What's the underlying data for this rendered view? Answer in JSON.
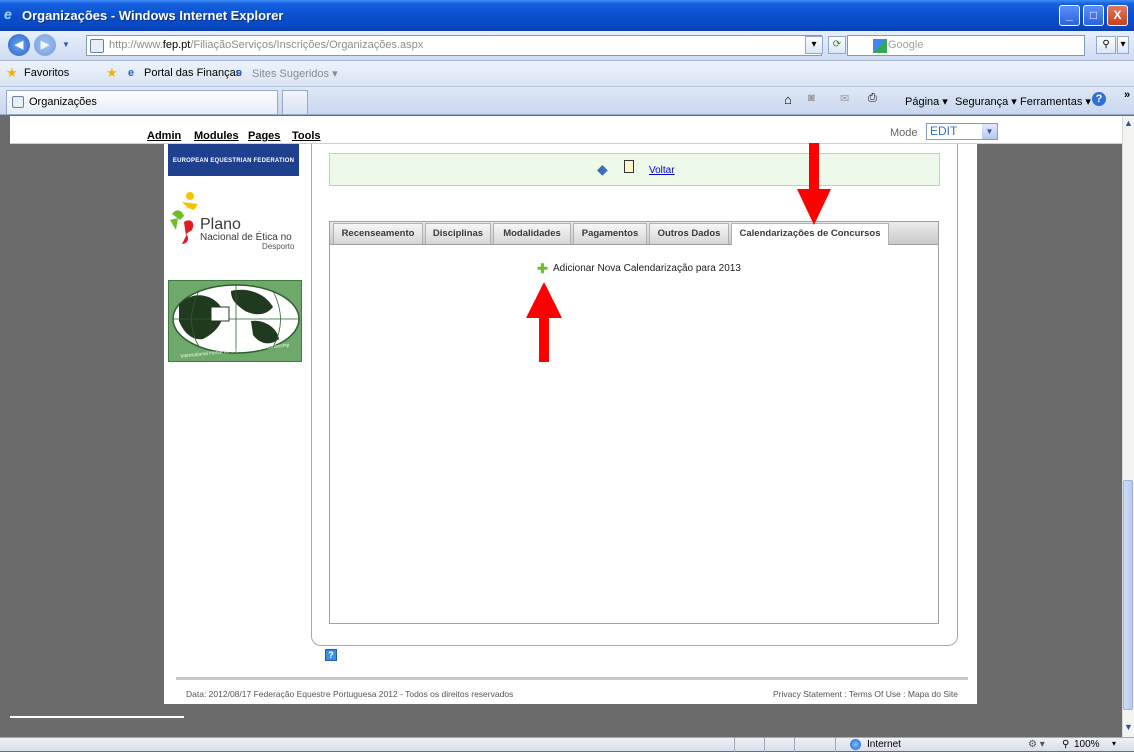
{
  "window": {
    "title": "Organizações - Windows Internet Explorer",
    "min_glyph": "_",
    "max_glyph": "□",
    "close_glyph": "X"
  },
  "address": {
    "url_prefix": "http://www.",
    "url_domain": "fep.pt",
    "url_path": "/FiliaçãoServiços/Inscrições/Organizações.aspx",
    "search_placeholder": "Google"
  },
  "favorites": {
    "favorites_label": "Favoritos",
    "links": [
      "Portal das Finanças",
      "Sites Sugeridos ▾"
    ]
  },
  "tabs": {
    "active_tab": "Organizações"
  },
  "commandbar": {
    "items": [
      "Página ▾",
      "Segurança ▾",
      "Ferramentas ▾"
    ],
    "more": "»"
  },
  "admin": {
    "links": [
      "Admin",
      "Modules",
      "Pages",
      "Tools"
    ],
    "mode_label": "Mode",
    "mode_value": "EDIT"
  },
  "sidebar": {
    "efe_text": "EUROPEAN EQUESTRIAN FEDERATION",
    "plano_title": "Plano",
    "plano_sub": "Nacional de Ética no",
    "plano_sub2": "Desporto",
    "globe_text": "International Horse for Equestrian Sportsmanship"
  },
  "panel": {
    "voltar": "Voltar",
    "tabs": [
      "Recenseamento",
      "Disciplinas",
      "Modalidades",
      "Pagamentos",
      "Outros Dados",
      "Calendarizações de Concursos"
    ],
    "active_tab_index": 5,
    "add_label": "Adicionar Nova Calendarização para 2013"
  },
  "footer": {
    "left": "Data:  2012/08/17   Federação Equestre Portuguesa 2012 - Todos os direitos reservados",
    "right": "Privacy Statement : Terms Of Use : Mapa do Site"
  },
  "status": {
    "zone": "Internet",
    "zoom": "100%"
  },
  "colors": {
    "arrow": "#ff0000",
    "accent_green": "#eefae9",
    "ie_blue": "#0a4fd0"
  }
}
